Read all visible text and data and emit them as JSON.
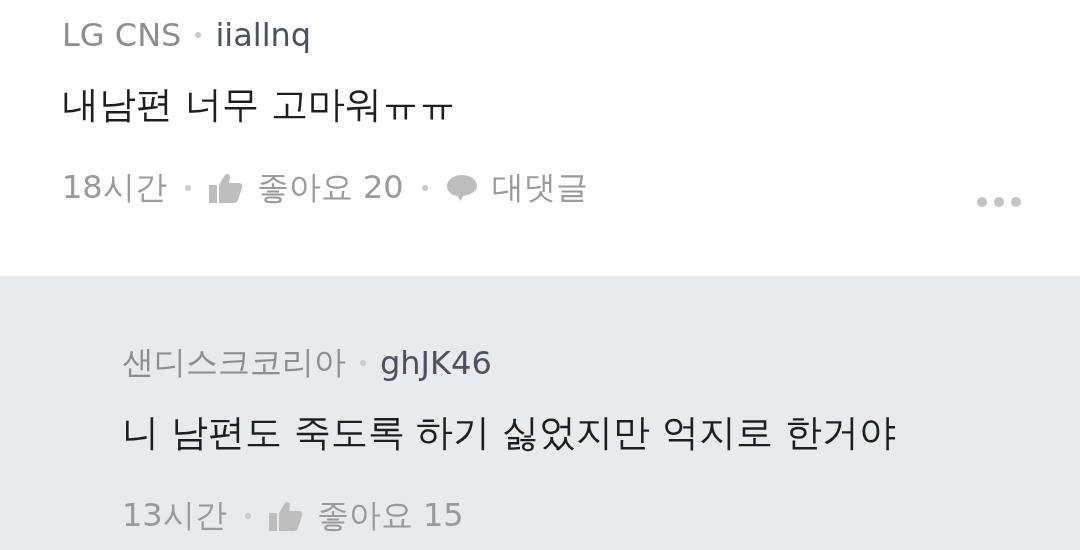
{
  "comments": [
    {
      "kind": "comment",
      "company": "LG CNS",
      "user": "iiallnq",
      "text": "내남편 너무 고마워ㅠㅠ",
      "time": "18시간",
      "likes": "좋아요 20",
      "reply": "대댓글",
      "more": true
    },
    {
      "kind": "reply",
      "company": "샌디스크코리아",
      "user": "ghJK46",
      "text": "니 남편도 죽도록 하기 싫었지만 억지로 한거야",
      "time": "13시간",
      "likes": "좋아요 15",
      "more": false
    }
  ]
}
